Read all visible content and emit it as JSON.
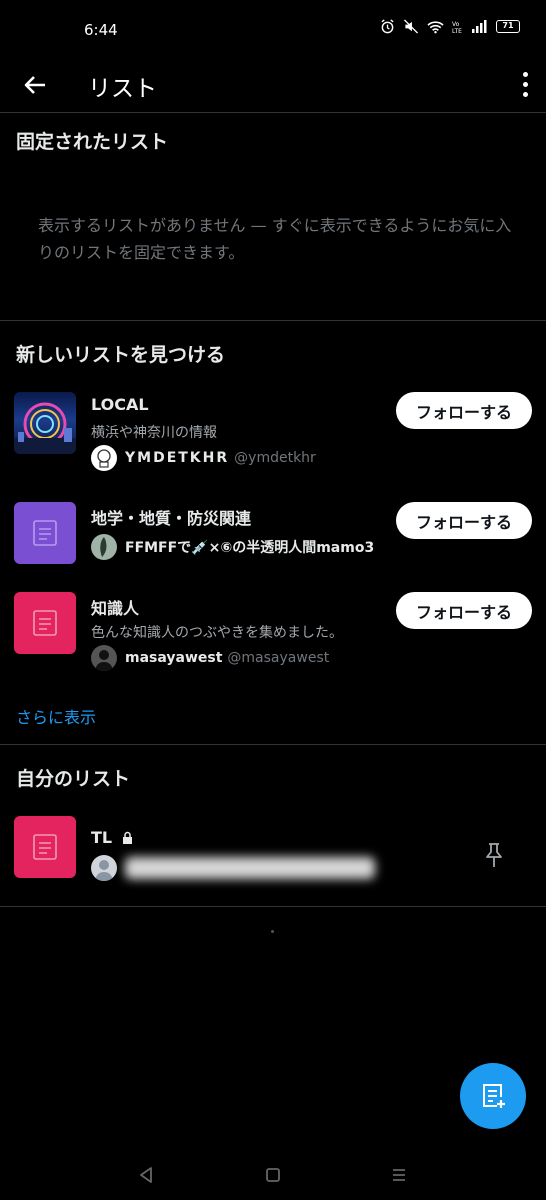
{
  "status_bar": {
    "time": "6:44",
    "battery": "71"
  },
  "header": {
    "title": "リスト"
  },
  "pinned": {
    "title": "固定されたリスト",
    "empty_message": "表示するリストがありません — すぐに表示できるようにお気に入りのリストを固定できます。"
  },
  "discover": {
    "title": "新しいリストを見つける",
    "follow_label": "フォローする",
    "show_more": "さらに表示",
    "items": [
      {
        "name": "LOCAL",
        "description": "横浜や神奈川の情報",
        "owner_name": "YMDETKHR",
        "owner_handle": "@ymdetkhr",
        "thumbnail": "city-night-photo"
      },
      {
        "name": "地学・地質・防災関連",
        "description": "",
        "owner_name": "FFMFFで💉×⑥の半透明人間mamo3",
        "owner_handle": "",
        "thumbnail": "list-icon"
      },
      {
        "name": "知識人",
        "description": "色んな知識人のつぶやきを集めました。",
        "owner_name": "masayawest",
        "owner_handle": "@masayawest",
        "thumbnail": "list-icon"
      }
    ]
  },
  "my_lists": {
    "title": "自分のリスト",
    "items": [
      {
        "name": "TL",
        "thumbnail": "list-icon"
      }
    ]
  },
  "colors": {
    "background": "#000000",
    "accent": "#1d9bf0",
    "purple_thumb": "#7a4fd1",
    "pink_thumb": "#e3245e",
    "divider": "#2f3336"
  }
}
